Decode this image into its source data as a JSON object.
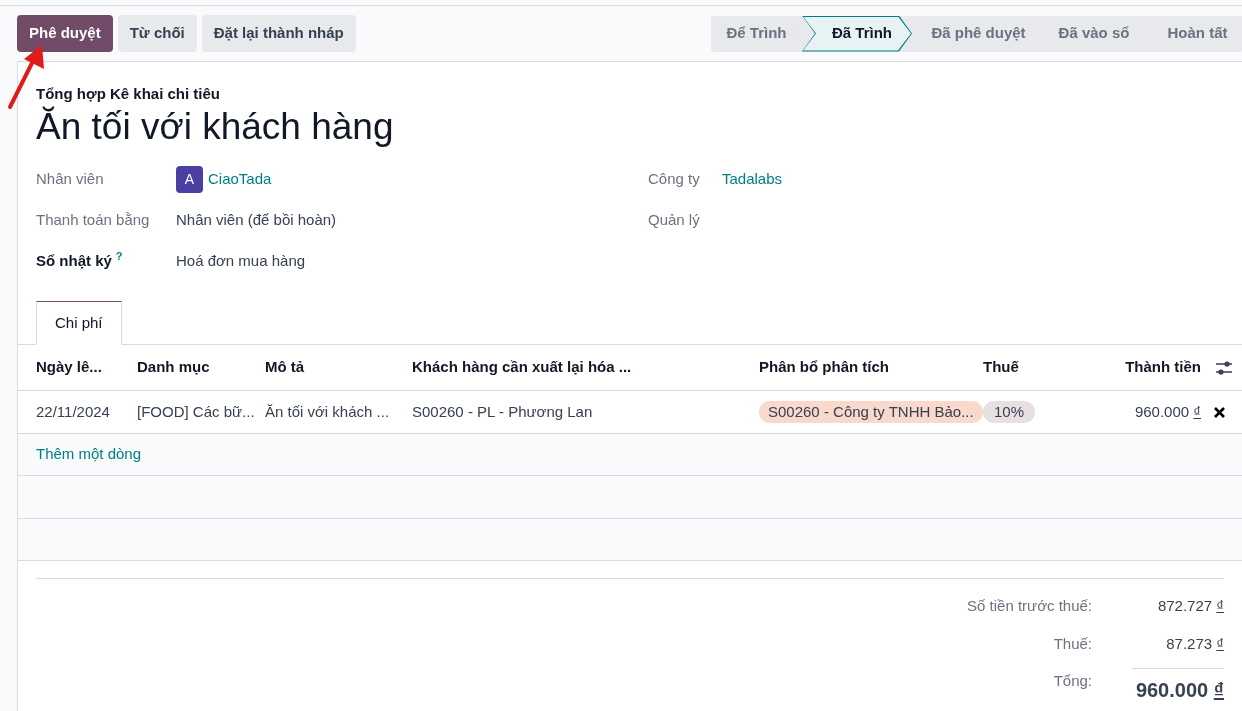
{
  "actions": [
    {
      "label": "Phê duyệt",
      "kind": "primary"
    },
    {
      "label": "Từ chối",
      "kind": "secondary"
    },
    {
      "label": "Đặt lại thành nháp",
      "kind": "secondary"
    }
  ],
  "stages": [
    {
      "label": "Để Trình",
      "selected": false
    },
    {
      "label": "Đã Trình",
      "selected": true
    },
    {
      "label": "Đã phê duyệt",
      "selected": false
    },
    {
      "label": "Đã vào sổ",
      "selected": false
    },
    {
      "label": "Hoàn tất",
      "selected": false
    }
  ],
  "form": {
    "subtitle": "Tổng hợp Kê khai chi tiêu",
    "title": "Ăn tối với khách hàng",
    "left_fields": [
      {
        "label": "Nhân viên",
        "value": "CiaoTada",
        "kind": "avatar-link",
        "avatar": "A",
        "required": false
      },
      {
        "label": "Thanh toán bằng",
        "value": "Nhân viên (để bồi hoàn)",
        "kind": "text",
        "required": false
      },
      {
        "label": "Sổ nhật ký",
        "value": "Hoá đơn mua hàng",
        "kind": "text",
        "required": true,
        "help": "?"
      }
    ],
    "right_fields": [
      {
        "label": "Công ty",
        "value": "Tadalabs",
        "kind": "link"
      },
      {
        "label": "Quản lý",
        "kind": "empty"
      }
    ]
  },
  "tabs": [
    {
      "label": "Chi phí",
      "selected": true
    }
  ],
  "table": {
    "columns": [
      "Ngày lê...",
      "Danh mục",
      "Mô tả",
      "Khách hàng cần xuất lại hóa ...",
      "Phân bổ phân tích",
      "Thuế",
      "Thành tiền"
    ],
    "rows": [
      {
        "date": "22/11/2024",
        "category": "[FOOD] Các bữ...",
        "description": "Ăn tối với khách ...",
        "customer": "S00260 - PL - Phương Lan",
        "analytic": "S00260 - Công ty TNHH Bảo...",
        "tax": "10%",
        "amount": "960.000",
        "currency": "₫"
      }
    ],
    "add_line": "Thêm một dòng"
  },
  "totals": [
    {
      "label": "Số tiền trước thuế:",
      "value": "872.727",
      "currency": "₫",
      "kind": "normal"
    },
    {
      "label": "Thuế:",
      "value": "87.273",
      "currency": "₫",
      "kind": "normal"
    },
    {
      "label": "Tổng:",
      "value": "960.000",
      "currency": "₫",
      "kind": "grand"
    }
  ]
}
